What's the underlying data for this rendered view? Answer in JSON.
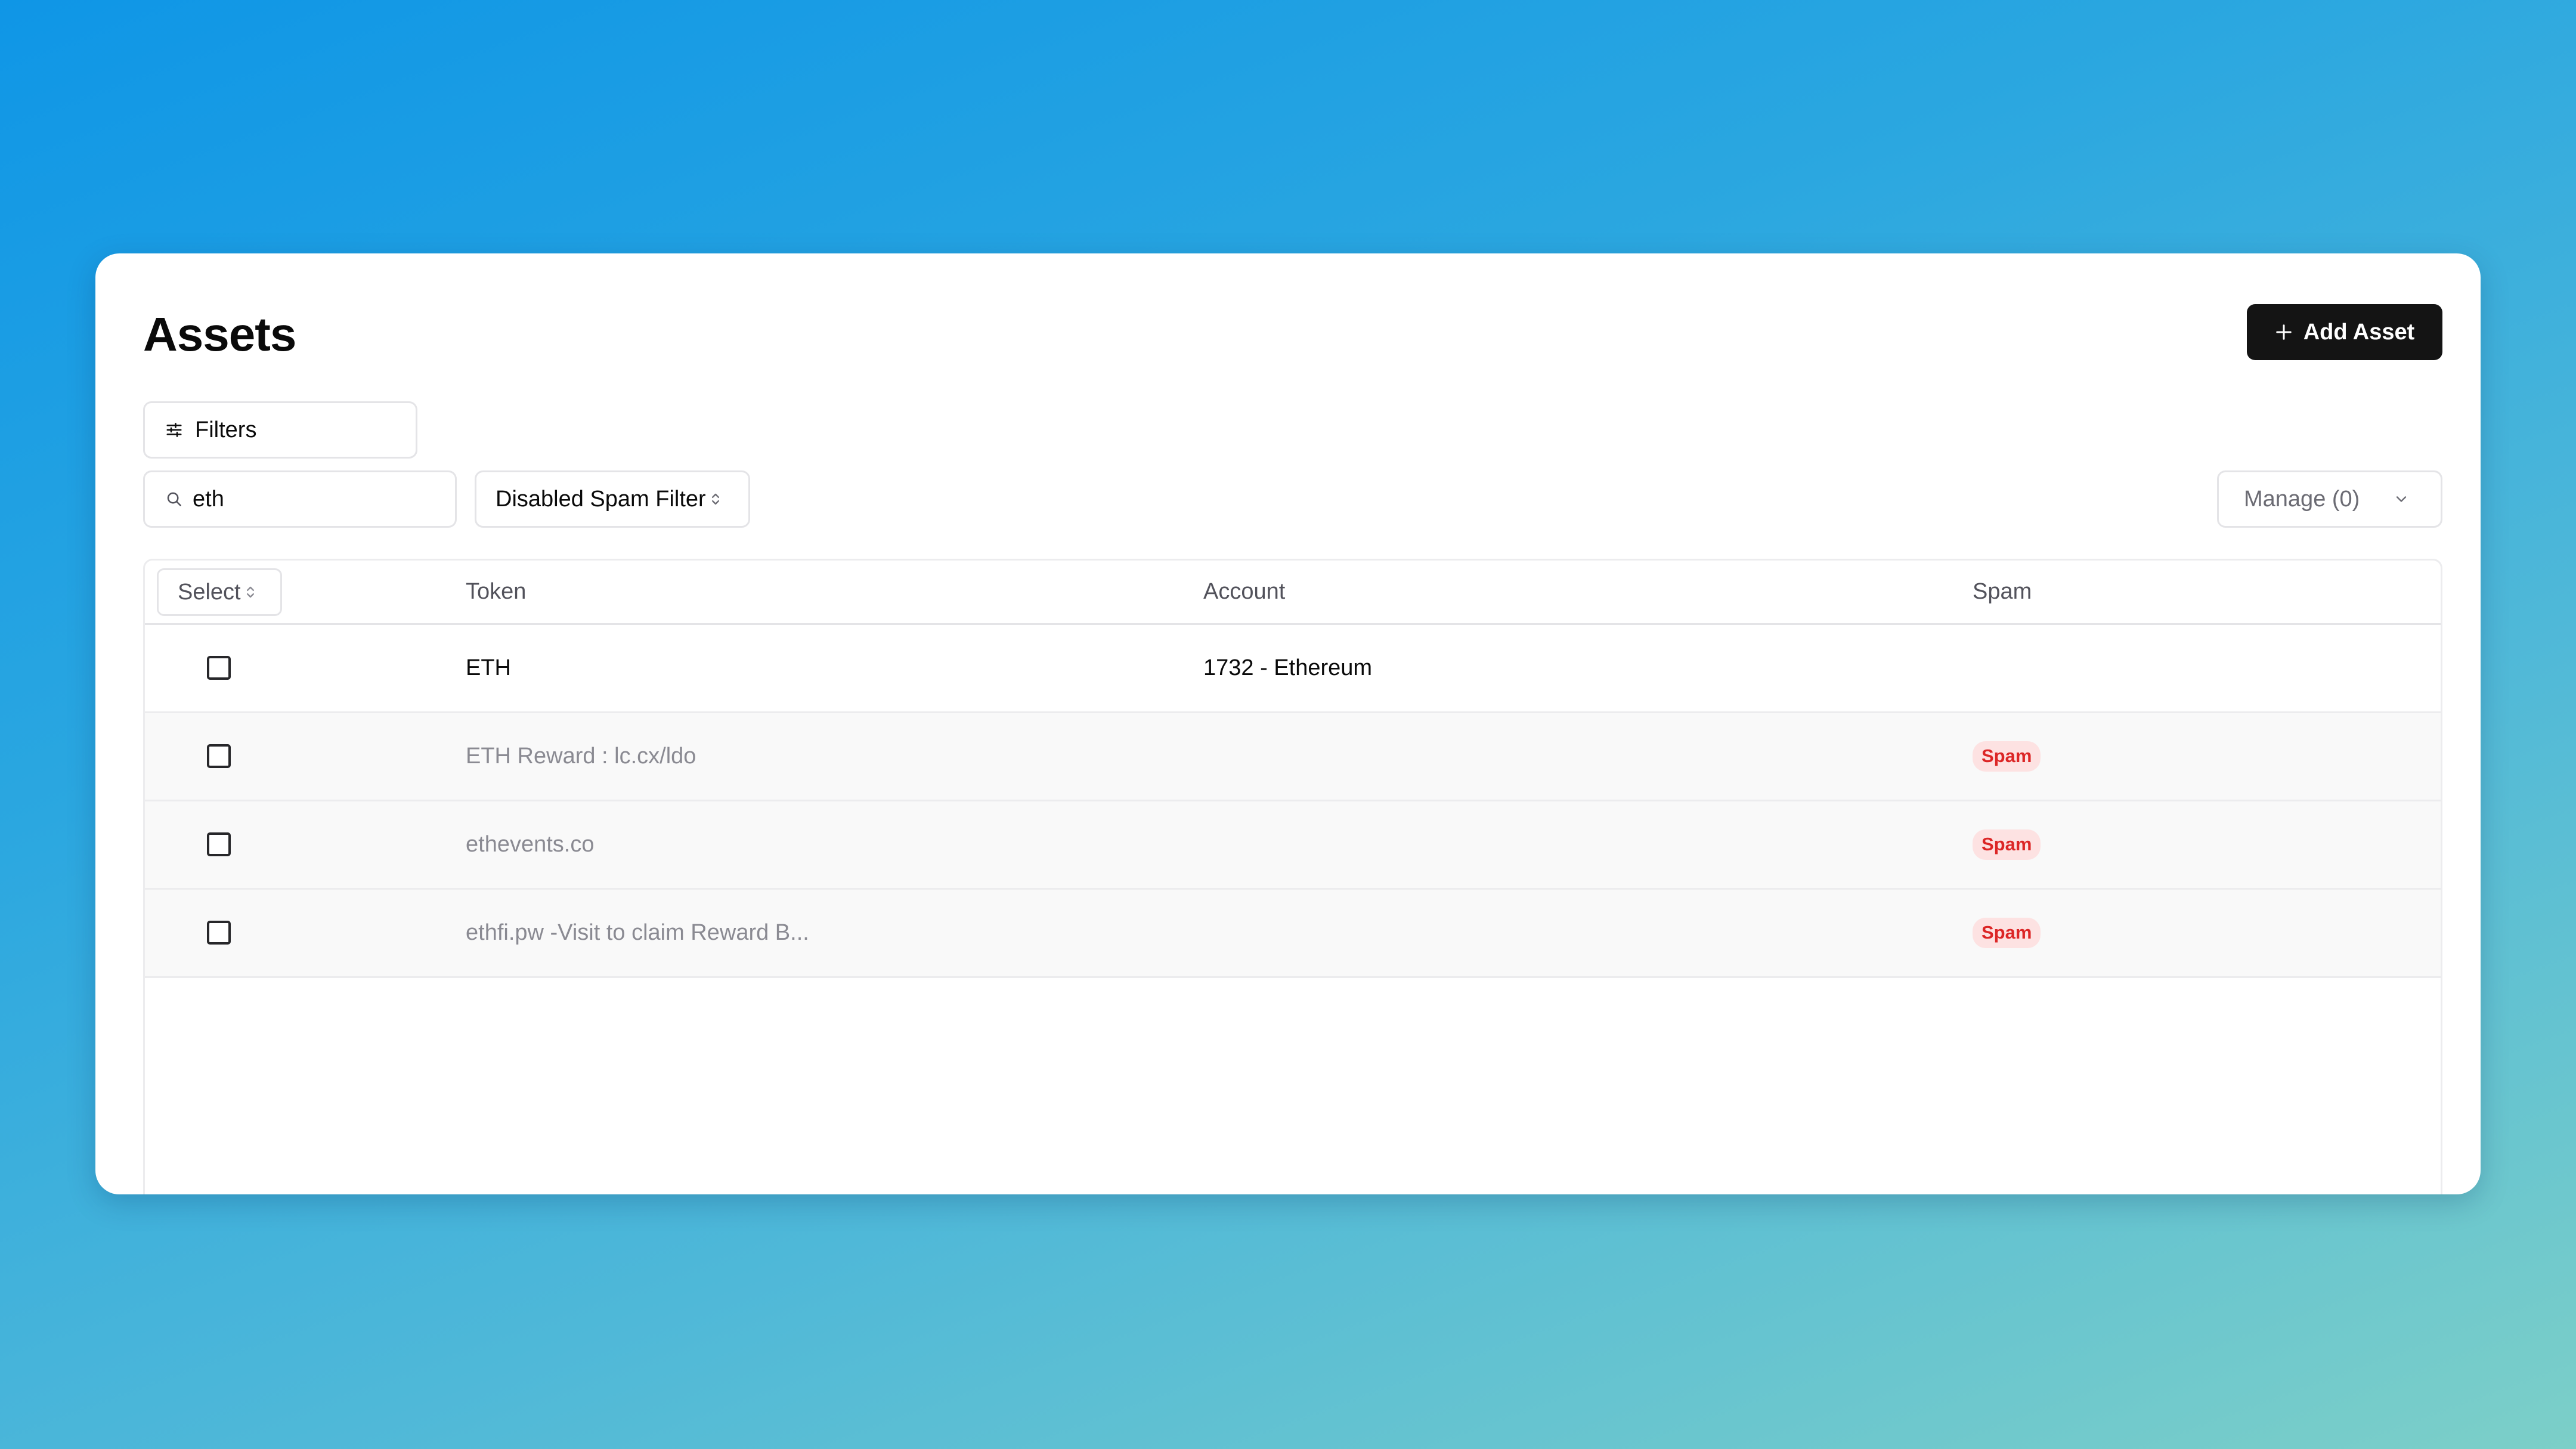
{
  "page": {
    "title": "Assets"
  },
  "toolbar": {
    "add_label": "Add Asset",
    "filters_label": "Filters",
    "search_value": "eth",
    "spam_filter_value": "Disabled Spam Filter",
    "manage_label": "Manage (0)"
  },
  "table": {
    "select_label": "Select",
    "columns": [
      "Token",
      "Account",
      "Spam"
    ],
    "rows": [
      {
        "token": "ETH",
        "account": "1732 - Ethereum",
        "spam": "",
        "checked": false
      },
      {
        "token": "ETH Reward : lc.cx/ldo",
        "account": "",
        "spam": "Spam",
        "checked": false
      },
      {
        "token": "ethevents.co",
        "account": "",
        "spam": "Spam",
        "checked": false
      },
      {
        "token": "ethfi.pw -Visit to claim Reward B...",
        "account": "",
        "spam": "Spam",
        "checked": false
      }
    ]
  },
  "colors": {
    "primary_button": "#141414",
    "spam_badge_bg": "#fde2e2",
    "spam_badge_text": "#dc2626",
    "background_top": "#0f96e6",
    "background_bottom": "#7ccfc8"
  }
}
